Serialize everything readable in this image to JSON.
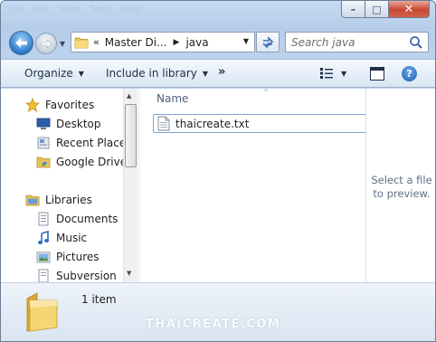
{
  "window": {
    "background_menu": [
      "File",
      "Edit",
      "View",
      "Tools",
      "Help"
    ],
    "caption_buttons": {
      "minimize": "–",
      "maximize": "□",
      "close": "✕"
    }
  },
  "address": {
    "overflow_chevron": "«",
    "crumbs": [
      "Master Di...",
      "java"
    ],
    "separator": "▶",
    "dropdown": "▼"
  },
  "search": {
    "placeholder": "Search java"
  },
  "toolbar": {
    "organize": "Organize",
    "include_in_library": "Include in library",
    "more": "»",
    "caret": "▼"
  },
  "nav": {
    "favorites": {
      "label": "Favorites",
      "items": [
        "Desktop",
        "Recent Places",
        "Google Drive"
      ]
    },
    "libraries": {
      "label": "Libraries",
      "items": [
        "Documents",
        "Music",
        "Pictures",
        "Subversion"
      ]
    },
    "scroll_up": "▲",
    "scroll_down": "▼"
  },
  "file_list": {
    "column_name": "Name",
    "sort_indicator": "^",
    "files": [
      {
        "name": "thaicreate.txt"
      }
    ]
  },
  "preview": {
    "message": "Select a file to preview."
  },
  "details": {
    "count": "1 item"
  },
  "watermark": "THAICREATE.COM",
  "colors": {
    "window_frame": "#bcd3ee",
    "toolbar_text": "#1e2f4a",
    "selection_border": "#7da2ce",
    "close_button": "#c7462e"
  }
}
